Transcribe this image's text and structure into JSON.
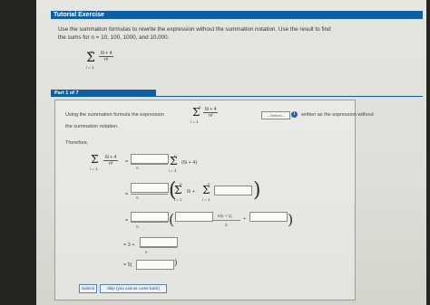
{
  "header": {
    "title": "Tutorial Exercise"
  },
  "problem": {
    "line1": "Use the summation formulas to rewrite the expression without the summation notation. Use the result to find",
    "line2": "the sums for n = 10, 100, 1000, and 10,000.",
    "sum": {
      "upper": "n",
      "lower": "i = 1",
      "numerator": "6i + 4",
      "denominator": "n²"
    }
  },
  "part": {
    "title": "Part 1 of 7"
  },
  "step": {
    "text_before": "Using the summation formula the expression",
    "select_label": "---Select---",
    "info_icon_label": "i",
    "text_after": "written as the expression without",
    "text_line2": "the summation notation.",
    "therefore": "Therefore,",
    "sum_inner_row1": "(6i + 4)",
    "n_den": "n",
    "sixi": "6i +",
    "n_over_2": "n(n + 1)",
    "two": "2",
    "plus": "+",
    "row4_prefix": "= 3 +",
    "row5_prefix": "= 5(",
    "equals": "="
  },
  "buttons": {
    "submit": "Submit",
    "skip": "Skip (you cannot come back)"
  }
}
